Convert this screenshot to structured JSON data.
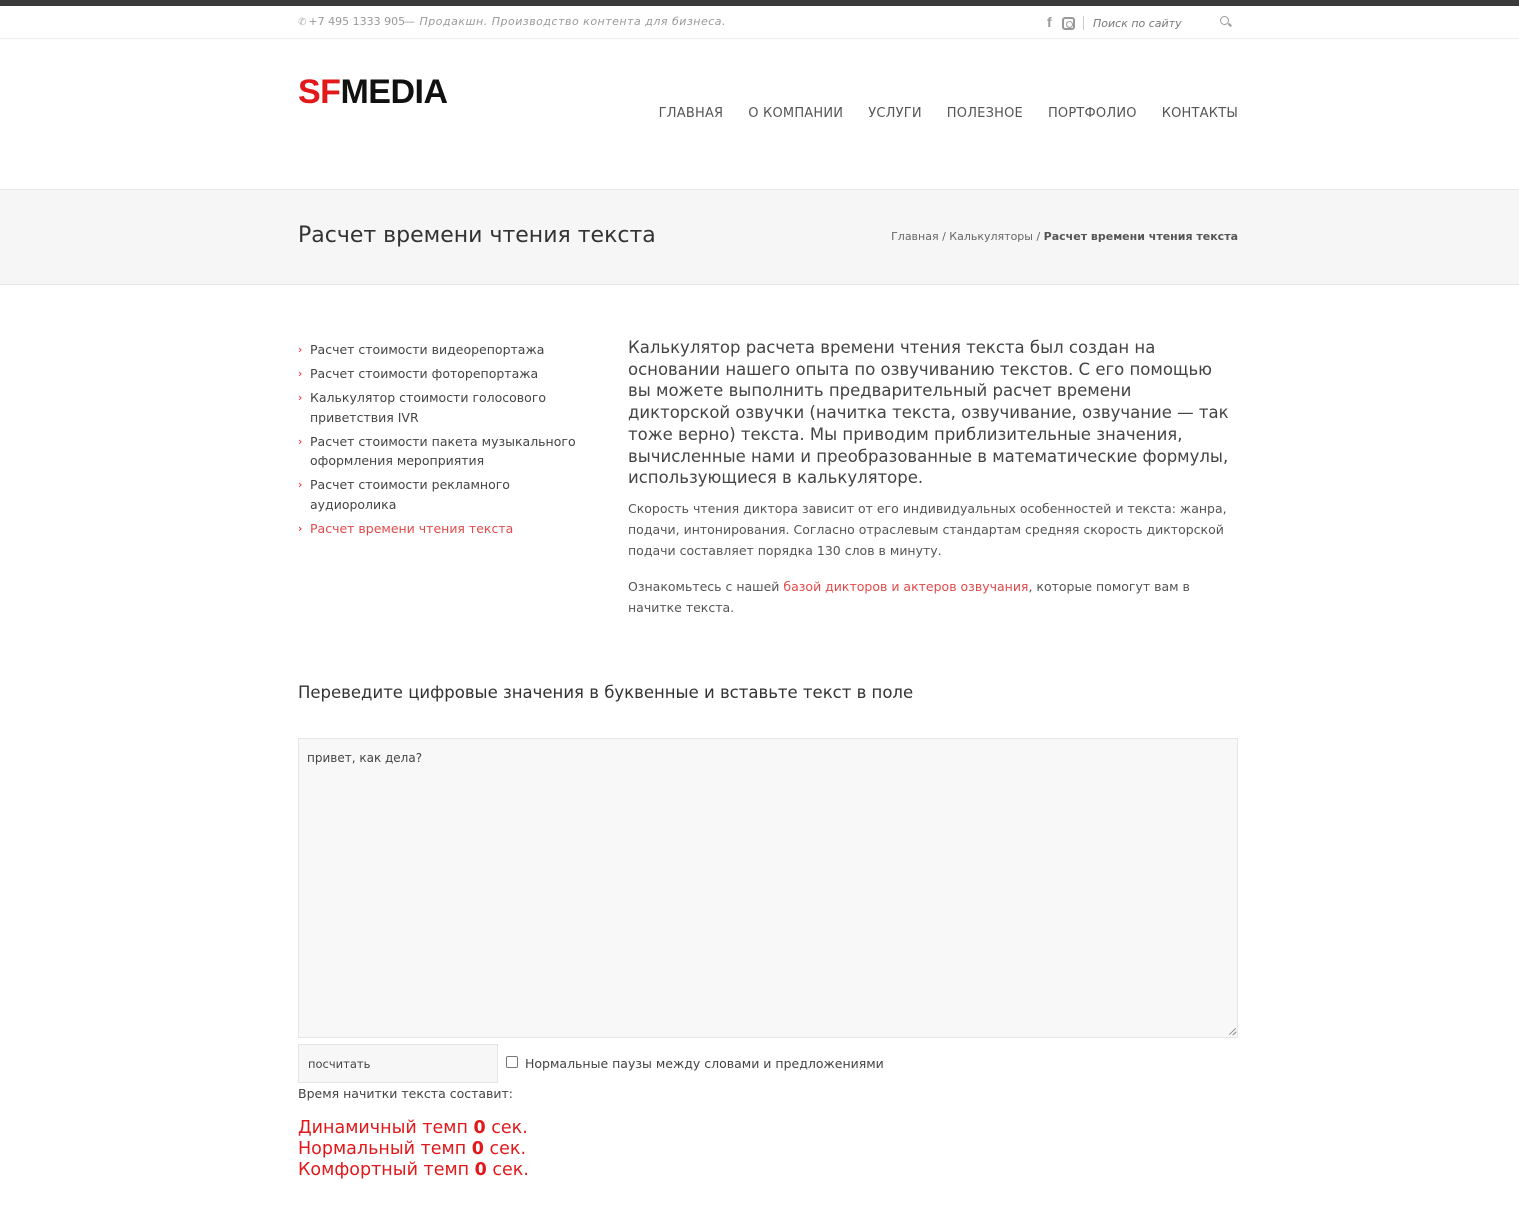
{
  "topbar": {
    "phone": "+7 495 1333 905",
    "tagline": "— Продакшн. Производство контента для бизнеса.",
    "facebook_glyph": "f",
    "search_placeholder": "Поиск по сайту"
  },
  "header": {
    "logo_sf": "SF",
    "logo_media": "MEDIA",
    "nav": [
      "ГЛАВНАЯ",
      "О КОМПАНИИ",
      "УСЛУГИ",
      "ПОЛЕЗНОЕ",
      "ПОРТФОЛИО",
      "КОНТАКТЫ"
    ]
  },
  "title_band": {
    "title": "Расчет времени чтения текста",
    "breadcrumb": {
      "home": "Главная",
      "sep": " / ",
      "section": "Калькуляторы",
      "current": "Расчет времени чтения текста"
    }
  },
  "sidebar": {
    "items": [
      "Расчет стоимости видеорепортажа",
      "Расчет стоимости фоторепортажа",
      "Калькулятор стоимости голосового приветствия IVR",
      "Расчет стоимости пакета музыкального оформления мероприятия",
      "Расчет стоимости рекламного аудиоролика",
      "Расчет времени чтения текста"
    ]
  },
  "intro": {
    "lead": "Калькулятор расчета времени чтения текста был создан на основании нашего опыта по озвучиванию текстов. С его помощью вы можете выполнить предварительный расчет времени дикторской озвучки (начитка текста, озвучивание, озвучание — так тоже верно) текста. Мы приводим приблизительные значения, вычисленные нами и преобразованные в математические формулы, использующиеся в калькуляторе.",
    "p1": "Скорость чтения диктора зависит от его индивидуальных особенностей и текста:  жанра, подачи, интонирования. Согласно отраслевым стандартам средняя скорость дикторской подачи составляет порядка 130 слов в минуту.",
    "p2_before": "Ознакомьтесь с нашей ",
    "p2_link": "базой дикторов и актеров озвучания",
    "p2_after": ", которые помогут вам в начитке текста."
  },
  "calculator": {
    "heading": "Переведите цифровые значения в буквенные и вставьте текст в поле",
    "text_value": "привет, как дела?",
    "button_label": "посчитать",
    "pause_label": "Нормальные паузы между словами и предложениями",
    "pause_checked": false,
    "time_label": "Время начитки текста составит:",
    "results": [
      {
        "label": "Динамичный темп ",
        "value": "0",
        "unit": " сек."
      },
      {
        "label": "Нормальный темп ",
        "value": "0",
        "unit": " сек."
      },
      {
        "label": "Комфортный темп ",
        "value": "0",
        "unit": " сек."
      }
    ]
  },
  "colors": {
    "accent": "#e2181a",
    "link": "#e24a4a",
    "stripe": "#3a3a3a"
  }
}
